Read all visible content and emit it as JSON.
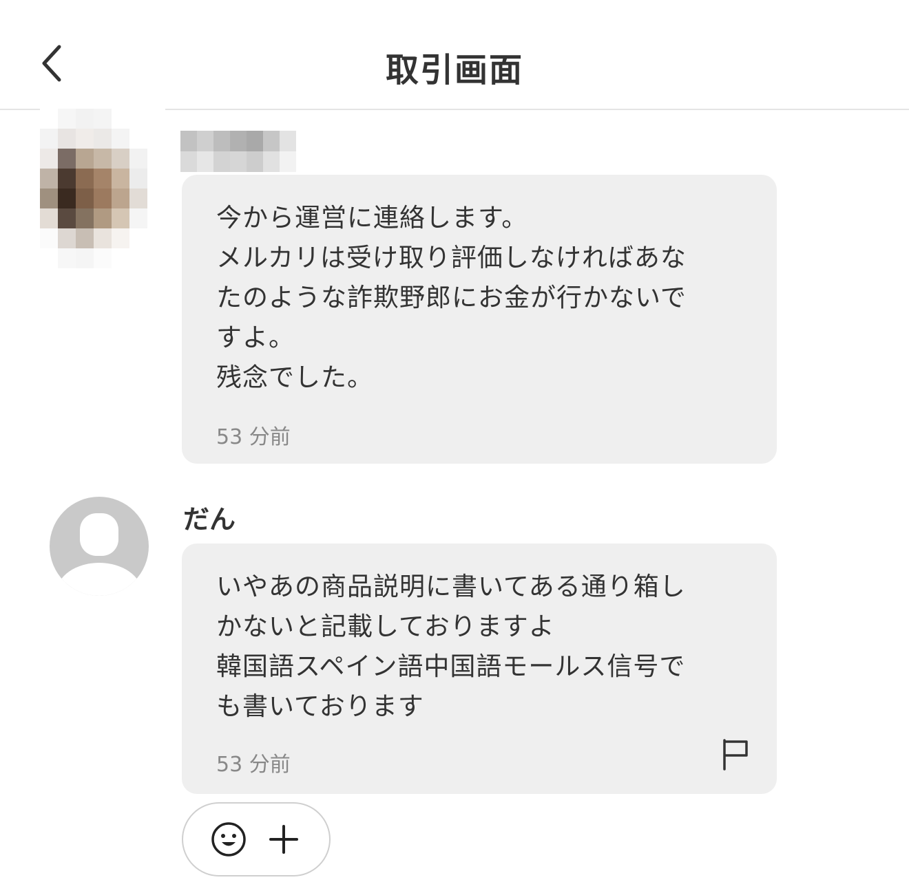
{
  "header": {
    "title": "取引画面",
    "back_icon": "chevron-left-icon"
  },
  "messages": [
    {
      "sender": "",
      "avatar": "pixelated-photo",
      "text": "今から運営に連絡します。\nメルカリは受け取り評価しなければあな\nたのような詐欺野郎にお金が行かないで\nすよ。\n残念でした。",
      "time": "53 分前"
    },
    {
      "sender": "だん",
      "avatar": "default-user-icon",
      "text": "いやあの商品説明に書いてある通り箱し\nかないと記載しておりますよ\n韓国語スペイン語中国語モールス信号で\nも書いております",
      "time": "53 分前",
      "report_icon": "flag-icon"
    }
  ],
  "reactions": {
    "emoji_icon": "smiley-icon",
    "add_icon": "plus-icon"
  },
  "colors": {
    "bubble": "#efefef",
    "text": "#333333",
    "muted": "#888888",
    "avatar_placeholder": "#c9c9c9"
  }
}
